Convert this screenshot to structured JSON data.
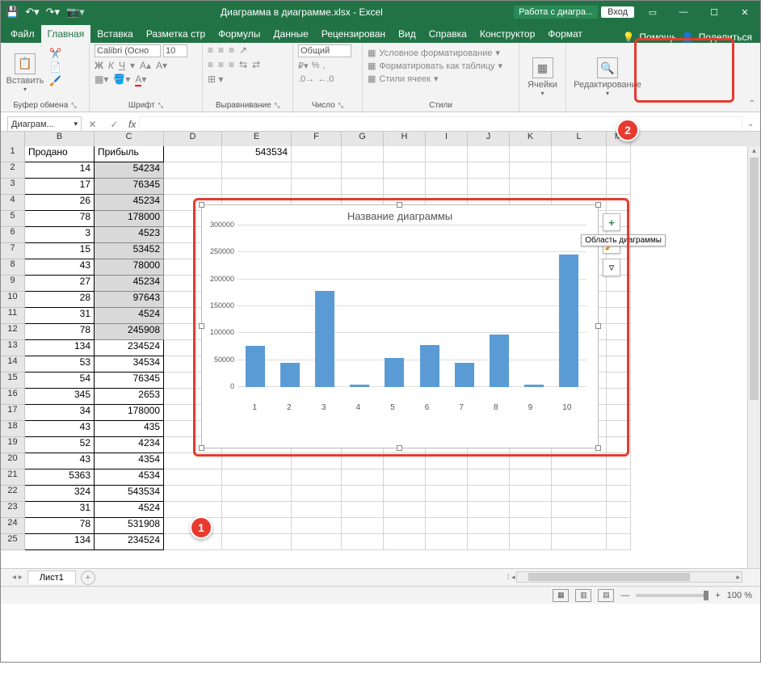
{
  "titlebar": {
    "app_title": "Диаграмма в диаграмме.xlsx  -  Excel",
    "chart_tools": "Работа с диагра...",
    "login": "Вход"
  },
  "tabs": [
    "Файл",
    "Главная",
    "Вставка",
    "Разметка стр",
    "Формулы",
    "Данные",
    "Рецензирован",
    "Вид",
    "Справка",
    "Конструктор",
    "Формат"
  ],
  "tabs_right": {
    "help": "Помощь",
    "share": "Поделиться"
  },
  "ribbon": {
    "clipboard": {
      "paste": "Вставить",
      "label": "Буфер обмена"
    },
    "font": {
      "name": "Calibri (Осно",
      "size": "10",
      "label": "Шрифт",
      "bold": "Ж",
      "italic": "К",
      "underline": "Ч"
    },
    "alignment": {
      "label": "Выравнивание"
    },
    "number": {
      "format": "Общий",
      "label": "Число"
    },
    "styles": {
      "cond": "Условное форматирование",
      "table": "Форматировать как таблицу",
      "cellstyles": "Стили ячеек",
      "label": "Стили"
    },
    "cells": {
      "label": "Ячейки"
    },
    "editing": {
      "label": "Редактирование"
    }
  },
  "namebox": "Диаграм...",
  "headers": {
    "B": "Продано",
    "C": "Прибыль",
    "E_val": "543534"
  },
  "data_rows": [
    {
      "b": "14",
      "c": "54234"
    },
    {
      "b": "17",
      "c": "76345"
    },
    {
      "b": "26",
      "c": "45234"
    },
    {
      "b": "78",
      "c": "178000"
    },
    {
      "b": "3",
      "c": "4523"
    },
    {
      "b": "15",
      "c": "53452"
    },
    {
      "b": "43",
      "c": "78000"
    },
    {
      "b": "27",
      "c": "45234"
    },
    {
      "b": "28",
      "c": "97643"
    },
    {
      "b": "31",
      "c": "4524"
    },
    {
      "b": "78",
      "c": "245908"
    },
    {
      "b": "134",
      "c": "234524"
    },
    {
      "b": "53",
      "c": "34534"
    },
    {
      "b": "54",
      "c": "76345"
    },
    {
      "b": "345",
      "c": "2653"
    },
    {
      "b": "34",
      "c": "178000"
    },
    {
      "b": "43",
      "c": "435"
    },
    {
      "b": "52",
      "c": "4234"
    },
    {
      "b": "43",
      "c": "4354"
    },
    {
      "b": "5363",
      "c": "4534"
    },
    {
      "b": "324",
      "c": "543534"
    },
    {
      "b": "31",
      "c": "4524"
    },
    {
      "b": "78",
      "c": "531908"
    },
    {
      "b": "134",
      "c": "234524"
    }
  ],
  "chart_data": {
    "type": "bar",
    "title": "Название диаграммы",
    "categories": [
      "1",
      "2",
      "3",
      "4",
      "5",
      "6",
      "7",
      "8",
      "9",
      "10"
    ],
    "values": [
      76345,
      45234,
      178000,
      4523,
      53452,
      78000,
      45234,
      97643,
      4524,
      245908
    ],
    "ylim": [
      0,
      300000
    ],
    "yticks": [
      0,
      50000,
      100000,
      150000,
      200000,
      250000,
      300000
    ],
    "tooltip": "Область диаграммы"
  },
  "sheet_tab": "Лист1",
  "zoom": "100 %",
  "callouts": {
    "c1": "1",
    "c2": "2"
  }
}
